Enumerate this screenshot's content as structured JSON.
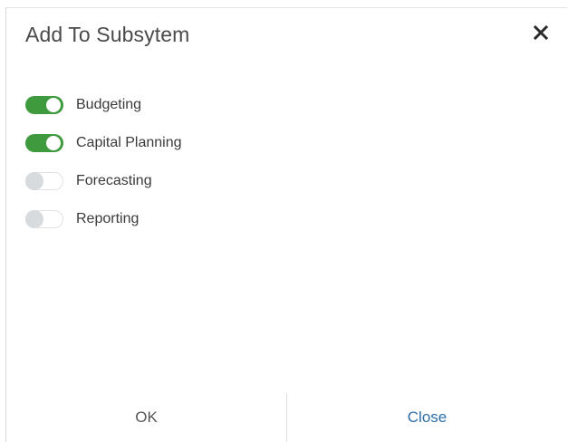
{
  "dialog": {
    "title": "Add To Subsytem",
    "close_icon": "close-icon"
  },
  "subsystems": [
    {
      "label": "Budgeting",
      "enabled": true
    },
    {
      "label": "Capital Planning",
      "enabled": true
    },
    {
      "label": "Forecasting",
      "enabled": false
    },
    {
      "label": "Reporting",
      "enabled": false
    }
  ],
  "footer": {
    "ok_label": "OK",
    "close_label": "Close"
  },
  "colors": {
    "toggle_on": "#3f9a3e",
    "toggle_off_knob": "#d8dbde",
    "close_button_text": "#2f6fa8",
    "title_text": "#4a4a4a"
  }
}
